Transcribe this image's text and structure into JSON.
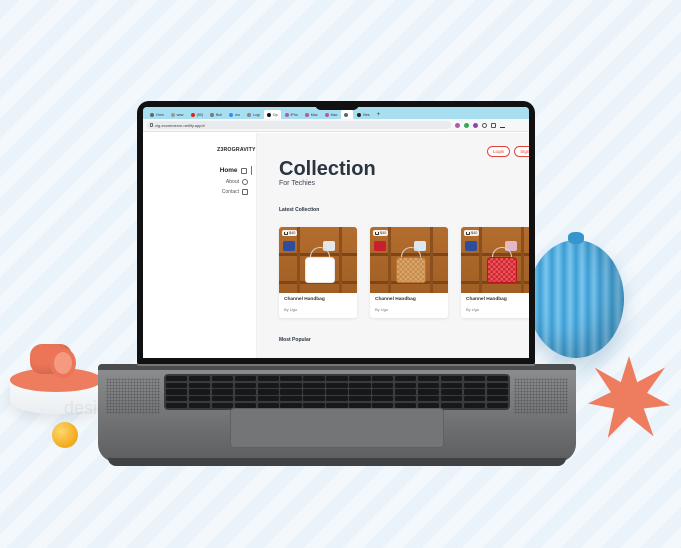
{
  "browser": {
    "tabs": [
      {
        "label": "Hom",
        "fav": "#666",
        "active": false
      },
      {
        "label": "wwv",
        "fav": "#999",
        "active": false
      },
      {
        "label": "(50)",
        "fav": "#e62117",
        "active": false
      },
      {
        "label": "Buil",
        "fav": "#7a7a7a",
        "active": false
      },
      {
        "label": "mo",
        "fav": "#4285f4",
        "active": false
      },
      {
        "label": "Logi",
        "fav": "#888",
        "active": false
      },
      {
        "label": "Op",
        "fav": "#111",
        "active": true
      },
      {
        "label": "iPho",
        "fav": "#b05ca8",
        "active": false
      },
      {
        "label": "Mac",
        "fav": "#b05ca8",
        "active": false
      },
      {
        "label": "Mac",
        "fav": "#b05ca8",
        "active": false
      },
      {
        "label": "",
        "fav": "#666",
        "active": true
      },
      {
        "label": "Bes",
        "fav": "#222",
        "active": false
      }
    ],
    "url": "zig-ecommerce.netlify.app/#"
  },
  "sidebar": {
    "brand": "Z3ROGRAVITY",
    "items": [
      {
        "label": "Home",
        "icon": "home-icon",
        "active": true
      },
      {
        "label": "About",
        "icon": "info-icon",
        "active": false
      },
      {
        "label": "Contact",
        "icon": "mail-icon",
        "active": false
      }
    ]
  },
  "header": {
    "login_label": "Login",
    "signup_label": "Sign"
  },
  "main": {
    "title": "Collection",
    "subtitle": "For Techies",
    "latest_label": "Latest Collection",
    "popular_label": "Most Popular"
  },
  "products": [
    {
      "name": "Channel Handbag",
      "by": "By Ugo",
      "price": "$40",
      "bag_color": "#ffffff",
      "accent": "#e6e6e6"
    },
    {
      "name": "Channel Handbag",
      "by": "By Ugo",
      "price": "$40",
      "bag_color": "#c98a43",
      "accent": "#b87634"
    },
    {
      "name": "Channel Handbag",
      "by": "By Ugo",
      "price": "$40",
      "bag_color": "#d7222c",
      "accent": "#b9141d"
    }
  ],
  "decor": {
    "watermark": "designstripe",
    "accent": "#ee7c5f",
    "ball": "#3d9fd6"
  }
}
